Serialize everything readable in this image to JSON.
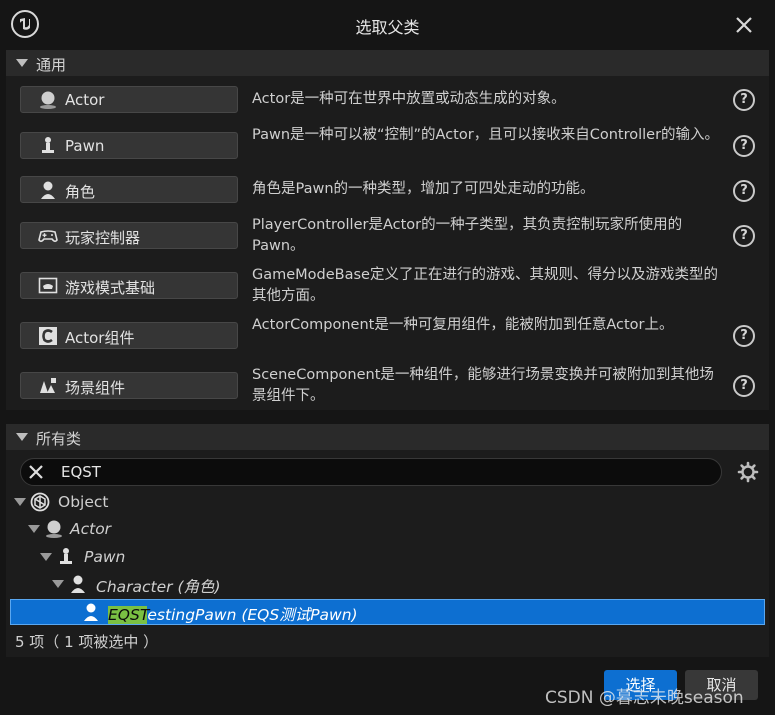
{
  "window": {
    "title": "选取父类"
  },
  "common_section": {
    "label": "通用",
    "items": [
      {
        "icon": "actor-sphere-icon",
        "label": "Actor",
        "description": "Actor是一种可在世界中放置或动态生成的对象。"
      },
      {
        "icon": "pawn-icon",
        "label": "Pawn",
        "description": "Pawn是一种可以被“控制”的Actor，且可以接收来自Controller的输入。"
      },
      {
        "icon": "character-icon",
        "label": "角色",
        "description": "角色是Pawn的一种类型，增加了可四处走动的功能。"
      },
      {
        "icon": "gamepad-icon",
        "label": "玩家控制器",
        "description": "PlayerController是Actor的一种子类型，其负责控制玩家所使用的Pawn。"
      },
      {
        "icon": "game-mode-icon",
        "label": "游戏模式基础",
        "description": "GameModeBase定义了正在进行的游戏、其规则、得分以及游戏类型的其他方面。"
      },
      {
        "icon": "actor-component-icon",
        "label": "Actor组件",
        "description": "ActorComponent是一种可复用组件，能被附加到任意Actor上。"
      },
      {
        "icon": "scene-component-icon",
        "label": "场景组件",
        "description": "SceneComponent是一种组件，能够进行场景变换并可被附加到其他场景组件下。"
      }
    ],
    "help_glyph": "?"
  },
  "all_classes_section": {
    "label": "所有类",
    "search": {
      "value": "EQST"
    },
    "tree": [
      {
        "name": "Object",
        "italic": false
      },
      {
        "name": "Actor",
        "italic": true
      },
      {
        "name": "Pawn",
        "italic": true
      },
      {
        "name": "Character (角色)",
        "italic": true
      },
      {
        "name_highlight": "EQST",
        "name_rest": "estingPawn (EQS测试Pawn)",
        "italic": true,
        "selected": true
      }
    ],
    "status": "5 项（ 1 项被选中 ）"
  },
  "footer": {
    "select_label": "选择",
    "cancel_label": "取消"
  },
  "watermark": "CSDN @暮志未晚season",
  "colors": {
    "accent": "#0d6fd1",
    "highlight": "#7ac043",
    "background": "#151515",
    "panel": "#1c1c1c"
  }
}
